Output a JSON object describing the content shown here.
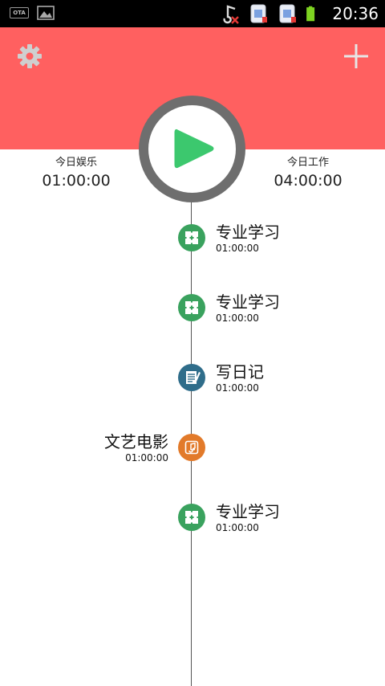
{
  "status_bar": {
    "ota_label": "OTA",
    "time": "20:36"
  },
  "stats": {
    "left_label": "今日娱乐",
    "left_value": "01:00:00",
    "right_label": "今日工作",
    "right_value": "04:00:00"
  },
  "colors": {
    "header": "#ff6060",
    "play": "#3cc86e",
    "study": "#3aa25e",
    "diary": "#2f6d8a",
    "movie": "#e27a2a"
  },
  "timeline": [
    {
      "title": "专业学习",
      "time": "01:00:00",
      "side": "right",
      "icon": "puzzle-icon"
    },
    {
      "title": "专业学习",
      "time": "01:00:00",
      "side": "right",
      "icon": "puzzle-icon"
    },
    {
      "title": "写日记",
      "time": "01:00:00",
      "side": "right",
      "icon": "notepad-icon"
    },
    {
      "title": "文艺电影",
      "time": "01:00:00",
      "side": "left",
      "icon": "music-note-icon"
    },
    {
      "title": "专业学习",
      "time": "01:00:00",
      "side": "right",
      "icon": "puzzle-icon"
    }
  ]
}
